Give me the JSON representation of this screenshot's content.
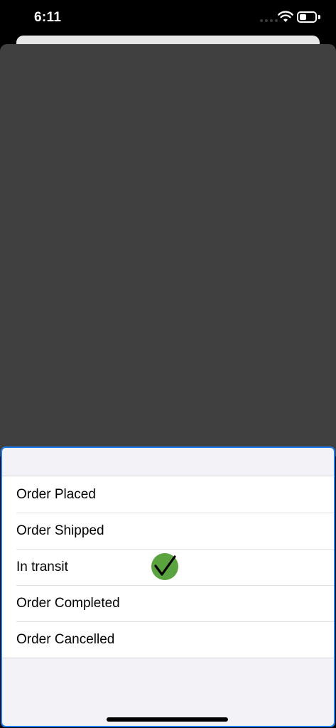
{
  "status_bar": {
    "time": "6:11",
    "icons": [
      "cellular-signal-icon",
      "wifi-icon",
      "battery-icon"
    ]
  },
  "picker": {
    "items": [
      {
        "label": "Order Placed",
        "selected": false
      },
      {
        "label": "Order Shipped",
        "selected": false
      },
      {
        "label": "In transit",
        "selected": true
      },
      {
        "label": "Order Completed",
        "selected": false
      },
      {
        "label": "Order Cancelled",
        "selected": false
      }
    ],
    "selected_icon": "checkmark-circle-icon"
  },
  "colors": {
    "dim_overlay": "#404040",
    "panel_border": "#1d7ae8",
    "check_fill": "#5aa33f",
    "panel_background": "#f2f2f7"
  }
}
